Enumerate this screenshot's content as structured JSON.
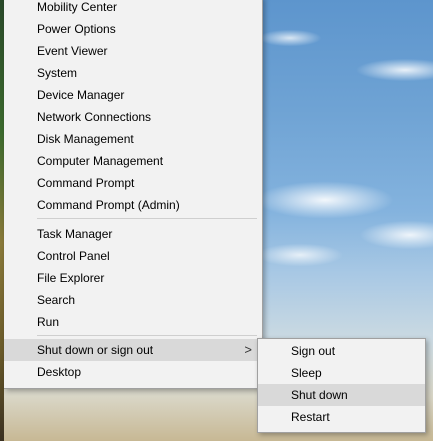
{
  "menu": {
    "group1": [
      "Mobility Center",
      "Power Options",
      "Event Viewer",
      "System",
      "Device Manager",
      "Network Connections",
      "Disk Management",
      "Computer Management",
      "Command Prompt",
      "Command Prompt (Admin)"
    ],
    "group2": [
      "Task Manager",
      "Control Panel",
      "File Explorer",
      "Search",
      "Run"
    ],
    "shutdown": "Shut down or sign out",
    "shutdown_arrow": ">",
    "desktop": "Desktop"
  },
  "submenu": {
    "items": [
      "Sign out",
      "Sleep",
      "Shut down",
      "Restart"
    ],
    "highlighted": "Shut down"
  }
}
